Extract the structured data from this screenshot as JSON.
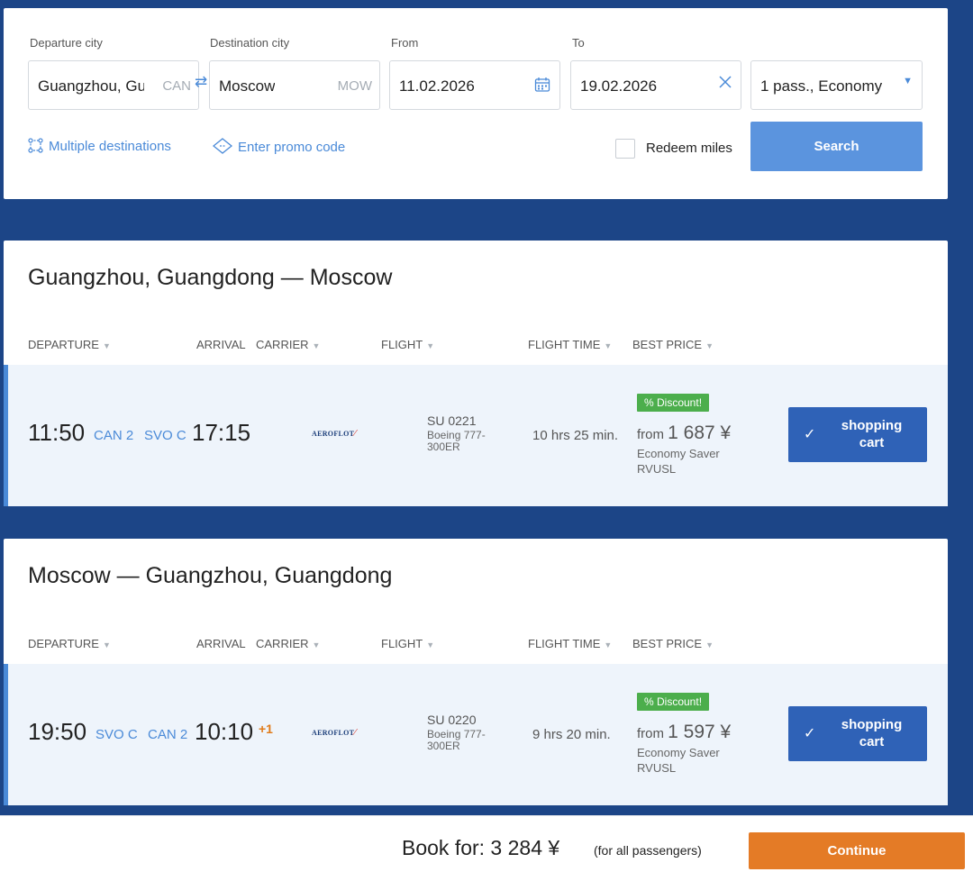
{
  "search": {
    "departure_label": "Departure city",
    "departure_value": "Guangzhou, Gu",
    "departure_code": "CAN",
    "destination_label": "Destination city",
    "destination_value": "Moscow",
    "destination_code": "MOW",
    "from_label": "From",
    "from_value": "11.02.2026",
    "to_label": "To",
    "to_value": "19.02.2026",
    "passengers_value": "1 pass., Economy",
    "multiple_destinations": "Multiple destinations",
    "promo_code": "Enter promo code",
    "redeem_miles": "Redeem miles",
    "search_button": "Search"
  },
  "columns": {
    "departure": "DEPARTURE",
    "arrival": "ARRIVAL",
    "carrier": "CARRIER",
    "flight": "FLIGHT",
    "flight_time": "FLIGHT TIME",
    "best_price": "BEST PRICE"
  },
  "routes": [
    {
      "title": "Guangzhou, Guangdong — Moscow",
      "flight": {
        "dep_time": "11:50",
        "dep_airport": "CAN 2",
        "arr_airport": "SVO C",
        "arr_time": "17:15",
        "plus_day": "",
        "carrier": "AEROFLOT",
        "flight_number": "SU 0221",
        "aircraft": "Boeing 777-300ER",
        "flight_time": "10 hrs 25 min.",
        "discount": "% Discount!",
        "price_prefix": "from",
        "price": "1 687 ¥",
        "fare_type": "Economy Saver RVUSL",
        "cart_label": "shopping cart"
      }
    },
    {
      "title": "Moscow — Guangzhou, Guangdong",
      "flight": {
        "dep_time": "19:50",
        "dep_airport": "SVO C",
        "arr_airport": "CAN 2",
        "arr_time": "10:10",
        "plus_day": "+1",
        "carrier": "AEROFLOT",
        "flight_number": "SU 0220",
        "aircraft": "Boeing 777-300ER",
        "flight_time": "9 hrs 20 min.",
        "discount": "% Discount!",
        "price_prefix": "from",
        "price": "1 597 ¥",
        "fare_type": "Economy Saver RVUSL",
        "cart_label": "shopping cart"
      }
    }
  ],
  "footer": {
    "book_label": "Book for:  3 284 ¥",
    "book_note": "(for all passengers)",
    "continue_button": "Continue"
  },
  "icons": {
    "swap": "swap-arrows-icon",
    "calendar": "calendar-icon",
    "clear": "close-icon",
    "dropdown": "caret-down-icon",
    "multi": "multiple-destinations-icon",
    "promo": "ticket-icon",
    "check": "check-icon"
  },
  "colors": {
    "background": "#1c4587",
    "accent": "#4a8ad8",
    "search_button": "#5b94de",
    "cart_button": "#2f62b7",
    "discount": "#4cae4c",
    "continue": "#e47b26"
  }
}
